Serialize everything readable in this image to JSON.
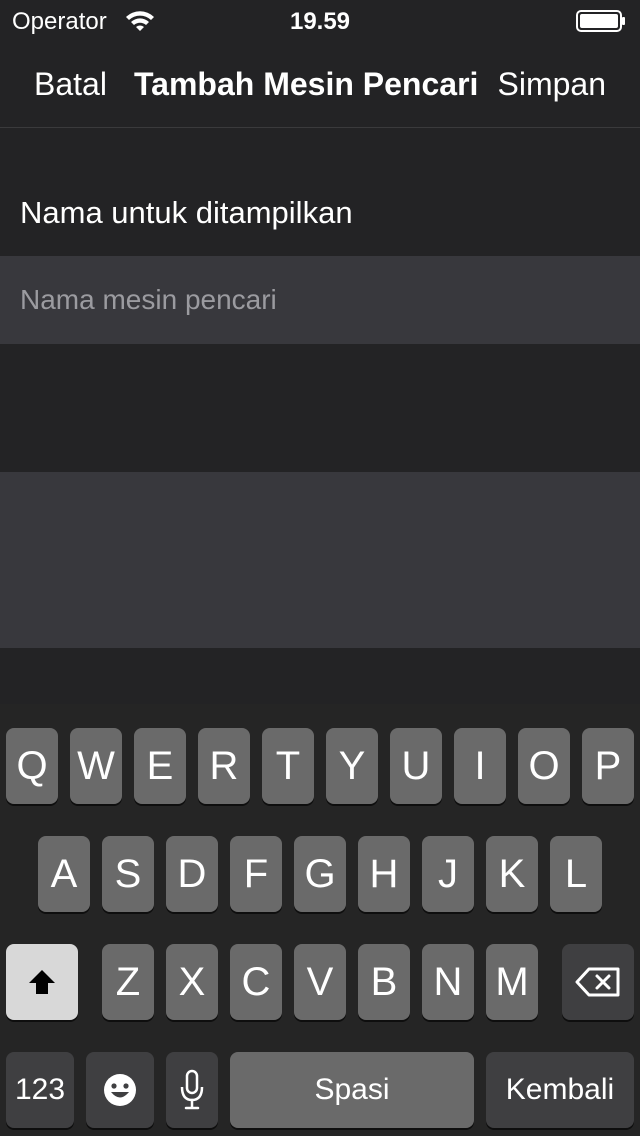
{
  "status": {
    "carrier": "Operator",
    "time": "19.59"
  },
  "nav": {
    "cancel": "Batal",
    "title": "Tambah Mesin Pencari",
    "save": "Simpan"
  },
  "form": {
    "name_label": "Nama untuk ditampilkan",
    "name_placeholder": "Nama mesin pencari",
    "name_value": ""
  },
  "keyboard": {
    "row1": [
      "Q",
      "W",
      "E",
      "R",
      "T",
      "Y",
      "U",
      "I",
      "O",
      "P"
    ],
    "row2": [
      "A",
      "S",
      "D",
      "F",
      "G",
      "H",
      "J",
      "K",
      "L"
    ],
    "row3": [
      "Z",
      "X",
      "C",
      "V",
      "B",
      "N",
      "M"
    ],
    "numbers_key": "123",
    "space_key": "Spasi",
    "return_key": "Kembali",
    "icons": {
      "shift": "shift-icon",
      "backspace": "backspace-icon",
      "emoji": "emoji-icon",
      "microphone": "microphone-icon"
    }
  },
  "colors": {
    "background": "#232325",
    "field": "#38383d",
    "key": "#6a6a6a",
    "key_dark": "#3f3f41",
    "shift_key": "#d8d8d8"
  }
}
